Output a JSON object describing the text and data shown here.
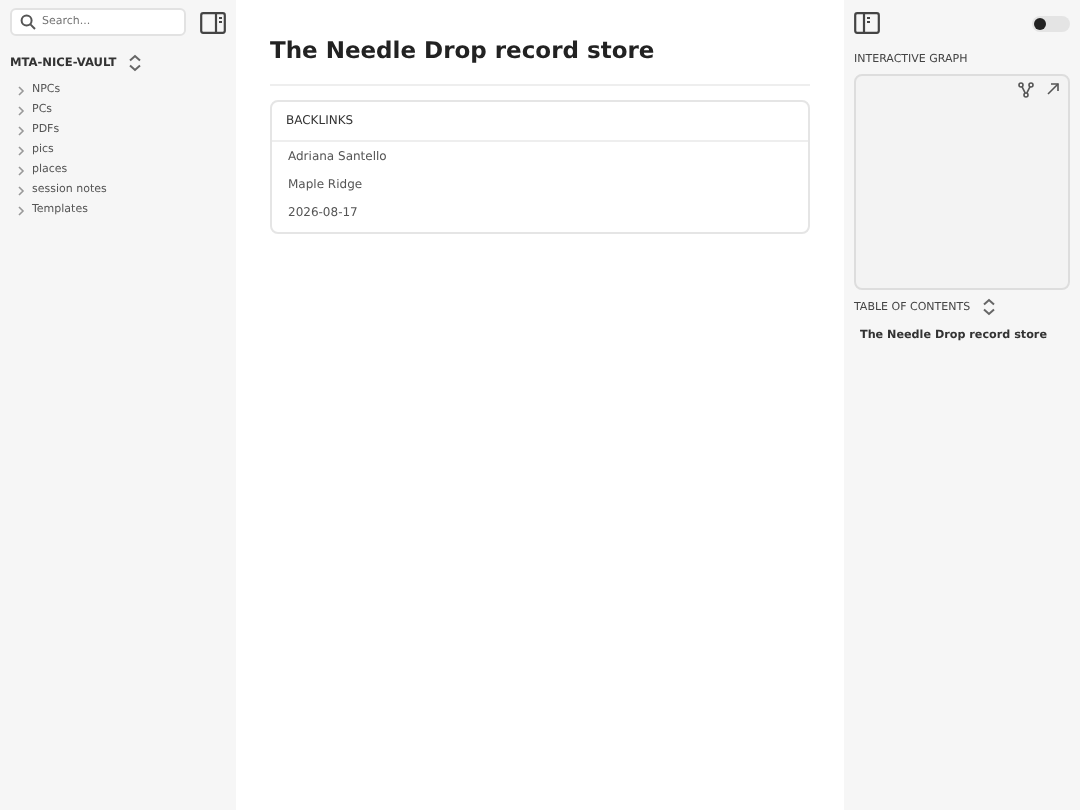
{
  "sidebar": {
    "search": {
      "placeholder": "Search..."
    },
    "vault_name": "MTA-NICE-VAULT",
    "folders": [
      {
        "label": "NPCs",
        "expanded": false
      },
      {
        "label": "PCs",
        "expanded": false
      },
      {
        "label": "PDFs",
        "expanded": false
      },
      {
        "label": "pics",
        "expanded": false
      },
      {
        "label": "places",
        "expanded": false
      },
      {
        "label": "session notes",
        "expanded": false
      },
      {
        "label": "Templates",
        "expanded": false
      }
    ]
  },
  "note": {
    "title": "The Needle Drop record store",
    "backlinks": {
      "heading": "BACKLINKS",
      "items": [
        "Adriana Santello",
        "Maple Ridge",
        "2026-08-17"
      ]
    }
  },
  "right_panel": {
    "theme_toggle": {
      "on": false
    },
    "graph": {
      "heading": "INTERACTIVE GRAPH"
    },
    "toc": {
      "heading": "TABLE OF CONTENTS",
      "items": [
        {
          "label": "The Needle Drop record store",
          "selected": false
        }
      ]
    }
  }
}
